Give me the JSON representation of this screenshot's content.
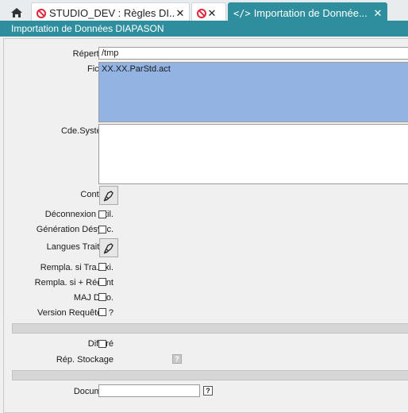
{
  "tabs": [
    {
      "label": "STUDIO_DEV : Règles DI..."
    },
    {
      "label": ""
    },
    {
      "label": "Importation de Donnée..."
    }
  ],
  "window": {
    "title": "Importation de Données DIAPASON"
  },
  "form": {
    "repertoire": {
      "label": "Répertoire",
      "value": "/tmp"
    },
    "fichier": {
      "label": "Fichier",
      "value": "XX.XX.ParStd.act"
    },
    "cde_systeme": {
      "label": "Cde.Système",
      "value": ""
    },
    "controle": {
      "label": "Contrôle"
    },
    "deconnexion": {
      "label": "Déconnexion Util.",
      "checked": false
    },
    "generation": {
      "label": "Génération Désync.",
      "checked": false
    },
    "langues": {
      "label": "Langues Traitées"
    },
    "rempla_tra": {
      "label": "Rempla. si Tra.Exi.",
      "checked": false
    },
    "rempla_recent": {
      "label": "Rempla. si + Récent",
      "checked": false
    },
    "maj_dico": {
      "label": "MAJ Dico.",
      "checked": false
    },
    "version_requetes": {
      "label": "Version Requêtes ?",
      "checked": false
    },
    "differe": {
      "label": "Différé",
      "checked": false
    },
    "rep_stockage": {
      "label": "Rép. Stockage"
    },
    "document": {
      "label": "Document",
      "value": ""
    },
    "help_glyph": "?"
  }
}
